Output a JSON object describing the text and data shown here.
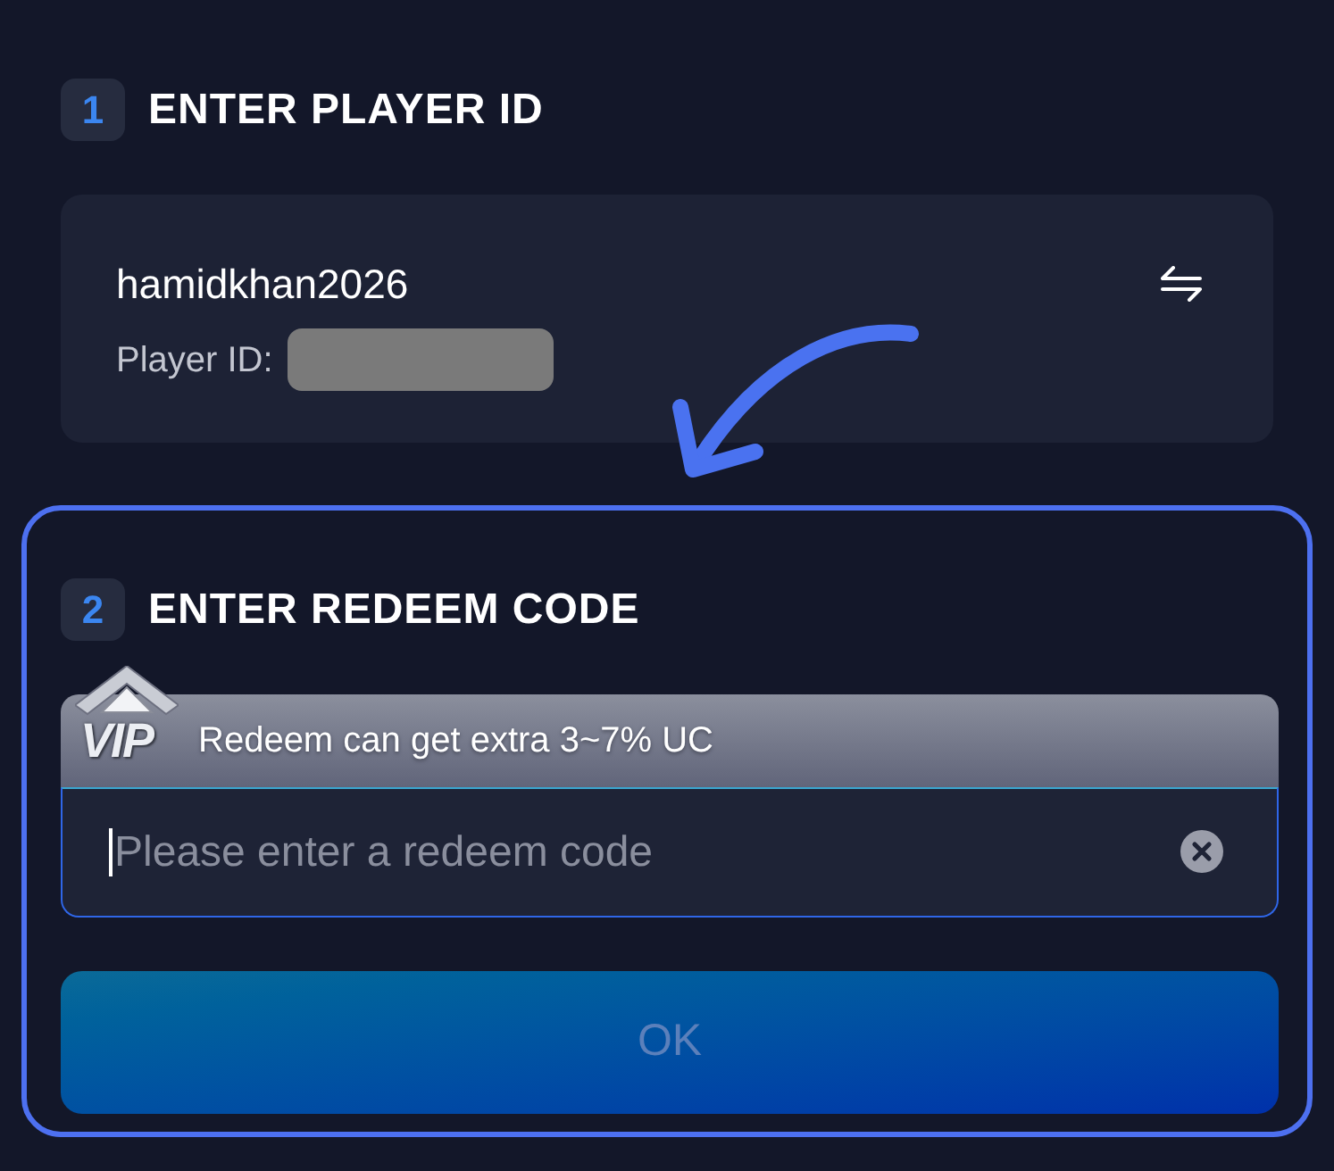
{
  "steps": [
    {
      "number": "1",
      "title": "ENTER PLAYER ID",
      "highlighted": false
    },
    {
      "number": "2",
      "title": "ENTER REDEEM CODE",
      "highlighted": true
    }
  ],
  "player_card": {
    "username": "hamidkhan2026",
    "id_label": "Player ID:"
  },
  "vip_banner": {
    "badge": "VIP",
    "text": "Redeem can get extra 3~7% UC"
  },
  "redeem_field": {
    "placeholder": "Please enter a redeem code",
    "focused": true
  },
  "ok_button": {
    "label": "OK",
    "disabled": true
  }
}
